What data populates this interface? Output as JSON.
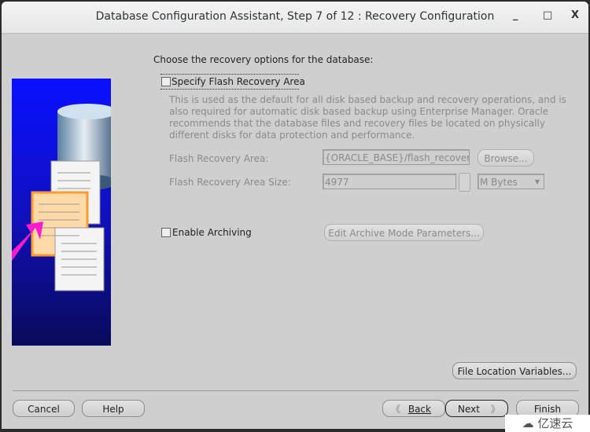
{
  "window": {
    "title": "Database Configuration Assistant, Step 7 of 12 : Recovery Configuration",
    "minimize": "_",
    "maximize": "□",
    "close": "X"
  },
  "main": {
    "heading": "Choose the recovery options for the database:",
    "flash": {
      "checkbox_label": "Specify Flash Recovery Area",
      "checked": false,
      "description": "This is used as the default for all disk based backup and recovery operations, and is also required for automatic disk based backup using Enterprise Manager. Oracle recommends that the database files and recovery files be located on physically different disks for data protection and performance.",
      "area_label": "Flash Recovery Area:",
      "area_value": "{ORACLE_BASE}/flash_recovery_",
      "browse_label": "Browse...",
      "size_label": "Flash Recovery Area Size:",
      "size_value": "4977",
      "unit_value": "M Bytes"
    },
    "archiving": {
      "checkbox_label": "Enable Archiving",
      "checked": false,
      "edit_label": "Edit Archive Mode Parameters..."
    },
    "file_location_label": "File Location Variables..."
  },
  "footer": {
    "cancel": "Cancel",
    "help": "Help",
    "back": "Back",
    "next": "Next",
    "finish": "Finish"
  },
  "watermark": "亿速云"
}
